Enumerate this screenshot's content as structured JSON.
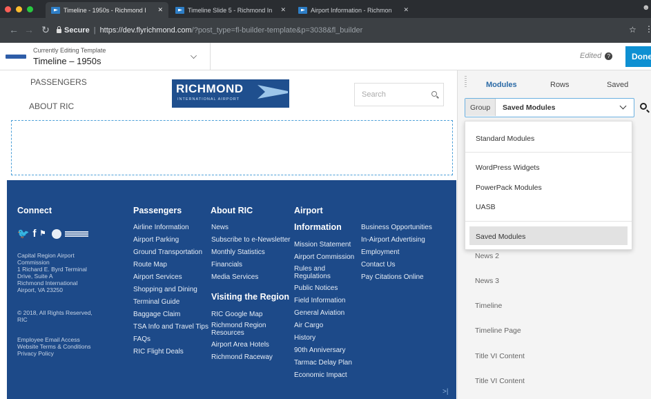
{
  "browser": {
    "tabs": [
      {
        "title": "Timeline - 1950s - Richmond I"
      },
      {
        "title": "Timeline Slide 5 - Richmond In"
      },
      {
        "title": "Airport Information - Richmon"
      }
    ],
    "url": {
      "secure_label": "Secure",
      "host": "https://dev.flyrichmond.com",
      "rest": "/?post_type=fl-builder-template&p=3038&fl_builder"
    }
  },
  "builder_bar": {
    "subtitle": "Currently Editing Template",
    "title": "Timeline – 1950s",
    "edited": "Edited",
    "done": "Done"
  },
  "page": {
    "nav": [
      "PASSENGERS",
      "ABOUT RIC"
    ],
    "logo": {
      "name": "RICHMOND",
      "subtitle": "INTERNATIONAL AIRPORT"
    },
    "search_placeholder": "Search"
  },
  "footer": {
    "connect": {
      "heading": "Connect",
      "address": [
        "Capital Region Airport",
        "Commission",
        "1 Richard E. Byrd Terminal",
        "Drive, Suite A",
        "Richmond International",
        "Airport, VA 23250"
      ],
      "copyright": [
        "© 2018, All Rights Reserved,",
        "RIC"
      ],
      "links": [
        "Employee Email Access",
        "Website Terms & Conditions",
        "Privacy Policy"
      ]
    },
    "passengers": {
      "heading": "Passengers",
      "links": [
        "Airline Information",
        "Airport Parking",
        "Ground Transportation",
        "Route Map",
        "Airport Services",
        "Shopping and Dining",
        "Terminal Guide",
        "Baggage Claim",
        "TSA Info and Travel Tips",
        "FAQs",
        "RIC Flight Deals"
      ]
    },
    "about": {
      "heading": "About RIC",
      "links": [
        "News",
        "Subscribe to e-Newsletter",
        "Monthly Statistics",
        "Financials",
        "Media Services"
      ]
    },
    "visiting": {
      "heading": "Visiting the Region",
      "links": [
        "RIC Google Map",
        "Richmond Region Resources",
        "Airport Area Hotels",
        "Richmond Raceway"
      ]
    },
    "airport": {
      "heading": [
        "Airport",
        "Information"
      ],
      "links": [
        "Mission Statement",
        "Airport Commission",
        "Rules and Regulations",
        "Public Notices",
        "Field Information",
        "General Aviation",
        "Air Cargo",
        "History",
        "90th Anniversary",
        "Tarmac Delay Plan",
        "Economic Impact"
      ]
    },
    "business": {
      "links": [
        "Business Opportunities",
        "In-Airport Advertising",
        "Employment",
        "Contact Us",
        "Pay Citations Online"
      ]
    }
  },
  "panel": {
    "tabs": [
      "Modules",
      "Rows",
      "Saved"
    ],
    "group_label": "Group",
    "selected": "Saved Modules",
    "menu": [
      "Standard Modules",
      "WordPress Widgets",
      "PowerPack Modules",
      "UASB",
      "Saved Modules"
    ],
    "list": [
      "News 2",
      "News 3",
      "Timeline",
      "Timeline Page",
      "Title VI Content",
      "Title VI Content"
    ]
  },
  "colors": {
    "accent": "#0e90d2",
    "footer_bg": "#1d4a89",
    "logo_bg": "#1f4f8e"
  }
}
